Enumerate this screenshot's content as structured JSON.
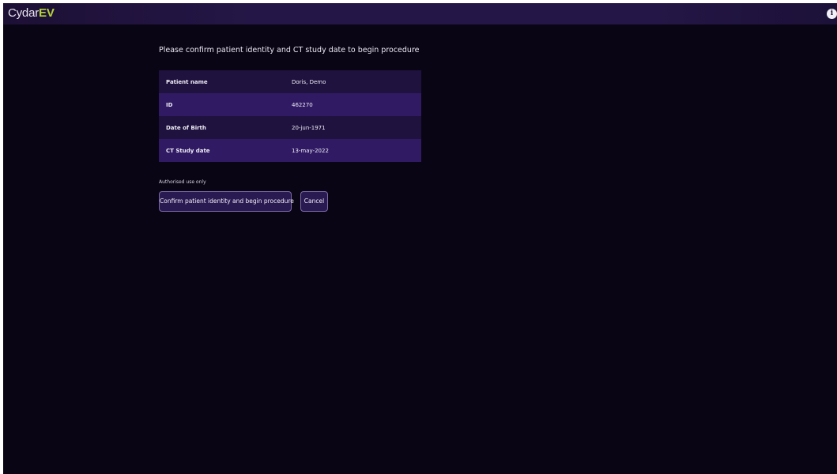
{
  "app": {
    "brand": "Cydar",
    "brand_suffix": "EV",
    "accent_color": "#b6d43a",
    "info_icon": "info-icon"
  },
  "confirm": {
    "heading": "Please confirm patient identity and CT study date to begin procedure",
    "rows": [
      {
        "label": "Patient name",
        "value": "Doris, Demo"
      },
      {
        "label": "ID",
        "value": "462270"
      },
      {
        "label": "Date of Birth",
        "value": "20-jun-1971"
      },
      {
        "label": "CT Study date",
        "value": "13-may-2022"
      }
    ],
    "authorised_note": "Authorised use only",
    "confirm_label": "Confirm patient identity and begin procedure",
    "cancel_label": "Cancel"
  }
}
